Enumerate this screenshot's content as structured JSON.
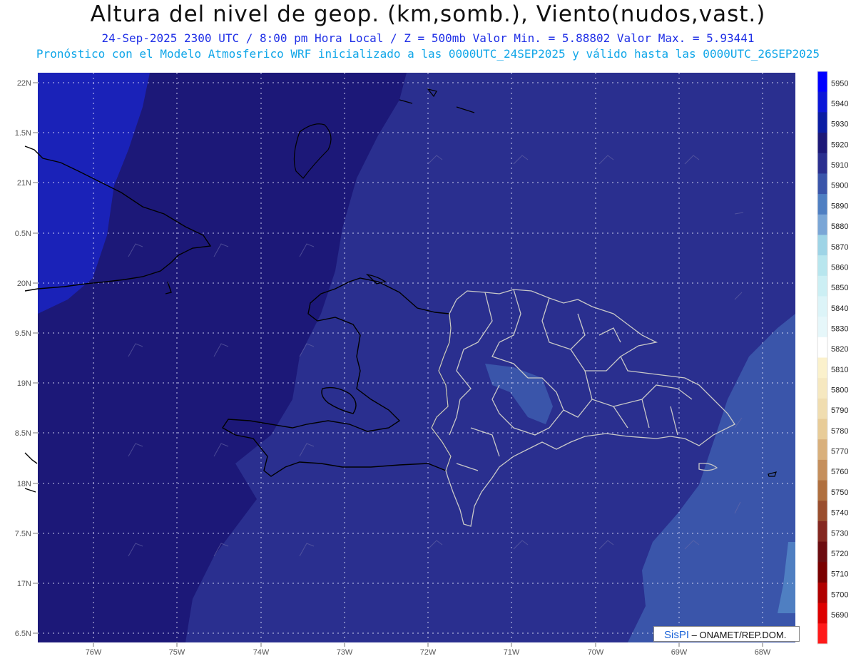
{
  "header": {
    "title": "Altura del nivel de geop. (km,somb.), Viento(nudos,vast.)",
    "subtitle": "24-Sep-2025  2300 UTC / 8:00 pm Hora Local / Z = 500mb     Valor Min. = 5.88802  Valor Max. = 5.93441",
    "model_line": "Pronóstico con el Modelo Atmosferico WRF inicializado a las 0000UTC_24SEP2025 y válido hasta las  0000UTC_26SEP2025"
  },
  "axes": {
    "lat_labels": [
      "22N",
      "1.5N",
      "21N",
      "0.5N",
      "20N",
      "9.5N",
      "19N",
      "8.5N",
      "18N",
      "7.5N",
      "17N",
      "6.5N"
    ],
    "lon_labels": [
      "76W",
      "75W",
      "74W",
      "73W",
      "72W",
      "71W",
      "70W",
      "69W",
      "68W"
    ]
  },
  "colorbar": {
    "labels": [
      5950,
      5940,
      5930,
      5920,
      5910,
      5900,
      5890,
      5880,
      5870,
      5860,
      5850,
      5840,
      5830,
      5820,
      5810,
      5800,
      5790,
      5780,
      5770,
      5760,
      5750,
      5740,
      5730,
      5720,
      5710,
      5700,
      5690
    ],
    "colors": [
      "#0000ff",
      "#0b16d8",
      "#0a1ca3",
      "#1c1878",
      "#2a2f8f",
      "#3a55aa",
      "#4f7fc2",
      "#7aa6d6",
      "#9ed4e6",
      "#b8e6ee",
      "#cceff4",
      "#dcf4f8",
      "#e6f7fa",
      "#ffffff",
      "#fbf1cc",
      "#f6e8c0",
      "#f0ddb0",
      "#e8cc98",
      "#d9b07c",
      "#c58f5c",
      "#b0703f",
      "#9a4e2e",
      "#842720",
      "#6c0c10",
      "#7a0000",
      "#b00000",
      "#dd0000",
      "#ff1a1a"
    ]
  },
  "credit": {
    "brand": "SisPI",
    "text": " – ONAMET/REP.DOM."
  }
}
